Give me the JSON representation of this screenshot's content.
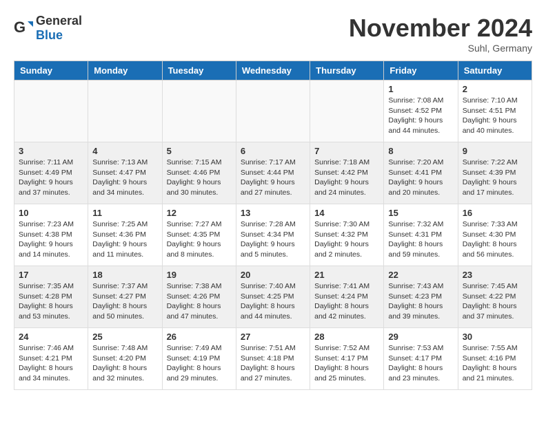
{
  "header": {
    "logo_general": "General",
    "logo_blue": "Blue",
    "month_title": "November 2024",
    "location": "Suhl, Germany"
  },
  "calendar": {
    "weekdays": [
      "Sunday",
      "Monday",
      "Tuesday",
      "Wednesday",
      "Thursday",
      "Friday",
      "Saturday"
    ],
    "rows": [
      {
        "cells": [
          {
            "day": "",
            "info": ""
          },
          {
            "day": "",
            "info": ""
          },
          {
            "day": "",
            "info": ""
          },
          {
            "day": "",
            "info": ""
          },
          {
            "day": "",
            "info": ""
          },
          {
            "day": "1",
            "info": "Sunrise: 7:08 AM\nSunset: 4:52 PM\nDaylight: 9 hours\nand 44 minutes."
          },
          {
            "day": "2",
            "info": "Sunrise: 7:10 AM\nSunset: 4:51 PM\nDaylight: 9 hours\nand 40 minutes."
          }
        ]
      },
      {
        "cells": [
          {
            "day": "3",
            "info": "Sunrise: 7:11 AM\nSunset: 4:49 PM\nDaylight: 9 hours\nand 37 minutes."
          },
          {
            "day": "4",
            "info": "Sunrise: 7:13 AM\nSunset: 4:47 PM\nDaylight: 9 hours\nand 34 minutes."
          },
          {
            "day": "5",
            "info": "Sunrise: 7:15 AM\nSunset: 4:46 PM\nDaylight: 9 hours\nand 30 minutes."
          },
          {
            "day": "6",
            "info": "Sunrise: 7:17 AM\nSunset: 4:44 PM\nDaylight: 9 hours\nand 27 minutes."
          },
          {
            "day": "7",
            "info": "Sunrise: 7:18 AM\nSunset: 4:42 PM\nDaylight: 9 hours\nand 24 minutes."
          },
          {
            "day": "8",
            "info": "Sunrise: 7:20 AM\nSunset: 4:41 PM\nDaylight: 9 hours\nand 20 minutes."
          },
          {
            "day": "9",
            "info": "Sunrise: 7:22 AM\nSunset: 4:39 PM\nDaylight: 9 hours\nand 17 minutes."
          }
        ]
      },
      {
        "cells": [
          {
            "day": "10",
            "info": "Sunrise: 7:23 AM\nSunset: 4:38 PM\nDaylight: 9 hours\nand 14 minutes."
          },
          {
            "day": "11",
            "info": "Sunrise: 7:25 AM\nSunset: 4:36 PM\nDaylight: 9 hours\nand 11 minutes."
          },
          {
            "day": "12",
            "info": "Sunrise: 7:27 AM\nSunset: 4:35 PM\nDaylight: 9 hours\nand 8 minutes."
          },
          {
            "day": "13",
            "info": "Sunrise: 7:28 AM\nSunset: 4:34 PM\nDaylight: 9 hours\nand 5 minutes."
          },
          {
            "day": "14",
            "info": "Sunrise: 7:30 AM\nSunset: 4:32 PM\nDaylight: 9 hours\nand 2 minutes."
          },
          {
            "day": "15",
            "info": "Sunrise: 7:32 AM\nSunset: 4:31 PM\nDaylight: 8 hours\nand 59 minutes."
          },
          {
            "day": "16",
            "info": "Sunrise: 7:33 AM\nSunset: 4:30 PM\nDaylight: 8 hours\nand 56 minutes."
          }
        ]
      },
      {
        "cells": [
          {
            "day": "17",
            "info": "Sunrise: 7:35 AM\nSunset: 4:28 PM\nDaylight: 8 hours\nand 53 minutes."
          },
          {
            "day": "18",
            "info": "Sunrise: 7:37 AM\nSunset: 4:27 PM\nDaylight: 8 hours\nand 50 minutes."
          },
          {
            "day": "19",
            "info": "Sunrise: 7:38 AM\nSunset: 4:26 PM\nDaylight: 8 hours\nand 47 minutes."
          },
          {
            "day": "20",
            "info": "Sunrise: 7:40 AM\nSunset: 4:25 PM\nDaylight: 8 hours\nand 44 minutes."
          },
          {
            "day": "21",
            "info": "Sunrise: 7:41 AM\nSunset: 4:24 PM\nDaylight: 8 hours\nand 42 minutes."
          },
          {
            "day": "22",
            "info": "Sunrise: 7:43 AM\nSunset: 4:23 PM\nDaylight: 8 hours\nand 39 minutes."
          },
          {
            "day": "23",
            "info": "Sunrise: 7:45 AM\nSunset: 4:22 PM\nDaylight: 8 hours\nand 37 minutes."
          }
        ]
      },
      {
        "cells": [
          {
            "day": "24",
            "info": "Sunrise: 7:46 AM\nSunset: 4:21 PM\nDaylight: 8 hours\nand 34 minutes."
          },
          {
            "day": "25",
            "info": "Sunrise: 7:48 AM\nSunset: 4:20 PM\nDaylight: 8 hours\nand 32 minutes."
          },
          {
            "day": "26",
            "info": "Sunrise: 7:49 AM\nSunset: 4:19 PM\nDaylight: 8 hours\nand 29 minutes."
          },
          {
            "day": "27",
            "info": "Sunrise: 7:51 AM\nSunset: 4:18 PM\nDaylight: 8 hours\nand 27 minutes."
          },
          {
            "day": "28",
            "info": "Sunrise: 7:52 AM\nSunset: 4:17 PM\nDaylight: 8 hours\nand 25 minutes."
          },
          {
            "day": "29",
            "info": "Sunrise: 7:53 AM\nSunset: 4:17 PM\nDaylight: 8 hours\nand 23 minutes."
          },
          {
            "day": "30",
            "info": "Sunrise: 7:55 AM\nSunset: 4:16 PM\nDaylight: 8 hours\nand 21 minutes."
          }
        ]
      }
    ]
  }
}
